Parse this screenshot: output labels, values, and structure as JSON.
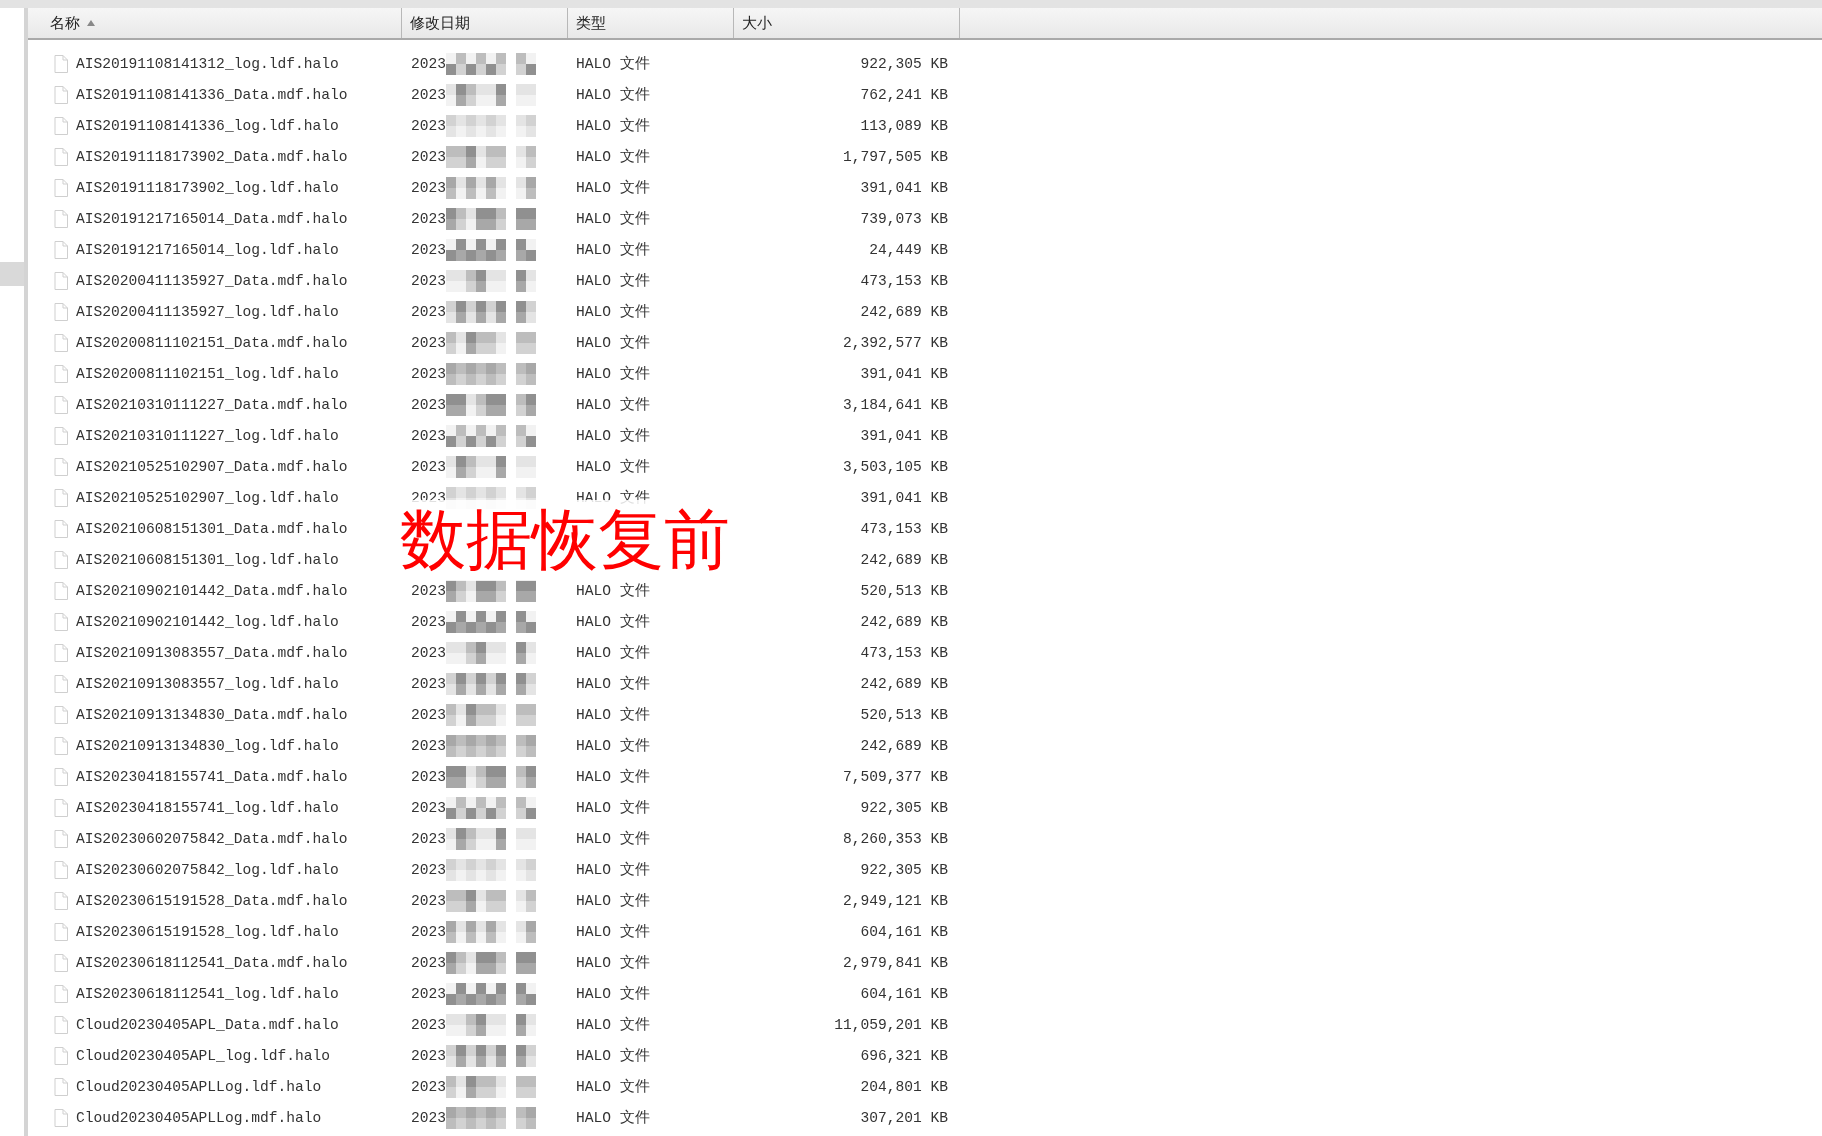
{
  "columns": [
    {
      "label": "名称",
      "sorted": true
    },
    {
      "label": "修改日期",
      "sorted": false
    },
    {
      "label": "类型",
      "sorted": false
    },
    {
      "label": "大小",
      "sorted": false
    }
  ],
  "rows": [
    {
      "name": "AIS20191108141312_log.ldf.halo",
      "date": "2023",
      "type": "HALO 文件",
      "size": "922,305 KB"
    },
    {
      "name": "AIS20191108141336_Data.mdf.halo",
      "date": "2023",
      "type": "HALO 文件",
      "size": "762,241 KB"
    },
    {
      "name": "AIS20191108141336_log.ldf.halo",
      "date": "2023",
      "type": "HALO 文件",
      "size": "113,089 KB"
    },
    {
      "name": "AIS20191118173902_Data.mdf.halo",
      "date": "2023",
      "type": "HALO 文件",
      "size": "1,797,505 KB"
    },
    {
      "name": "AIS20191118173902_log.ldf.halo",
      "date": "2023",
      "type": "HALO 文件",
      "size": "391,041 KB"
    },
    {
      "name": "AIS20191217165014_Data.mdf.halo",
      "date": "2023",
      "type": "HALO 文件",
      "size": "739,073 KB"
    },
    {
      "name": "AIS20191217165014_log.ldf.halo",
      "date": "2023",
      "type": "HALO 文件",
      "size": "24,449 KB"
    },
    {
      "name": "AIS20200411135927_Data.mdf.halo",
      "date": "2023",
      "type": "HALO 文件",
      "size": "473,153 KB"
    },
    {
      "name": "AIS20200411135927_log.ldf.halo",
      "date": "2023",
      "type": "HALO 文件",
      "size": "242,689 KB"
    },
    {
      "name": "AIS20200811102151_Data.mdf.halo",
      "date": "2023",
      "type": "HALO 文件",
      "size": "2,392,577 KB"
    },
    {
      "name": "AIS20200811102151_log.ldf.halo",
      "date": "2023",
      "type": "HALO 文件",
      "size": "391,041 KB"
    },
    {
      "name": "AIS20210310111227_Data.mdf.halo",
      "date": "2023",
      "type": "HALO 文件",
      "size": "3,184,641 KB"
    },
    {
      "name": "AIS20210310111227_log.ldf.halo",
      "date": "2023",
      "type": "HALO 文件",
      "size": "391,041 KB"
    },
    {
      "name": "AIS20210525102907_Data.mdf.halo",
      "date": "2023",
      "type": "HALO 文件",
      "size": "3,503,105 KB"
    },
    {
      "name": "AIS20210525102907_log.ldf.halo",
      "date": "2023",
      "type": "HALO 文件",
      "size": "391,041 KB"
    },
    {
      "name": "AIS20210608151301_Data.mdf.halo",
      "size": "473,153 KB"
    },
    {
      "name": "AIS20210608151301_log.ldf.halo",
      "size": "242,689 KB"
    },
    {
      "name": "AIS20210902101442_Data.mdf.halo",
      "date": "2023",
      "type": "HALO 文件",
      "size": "520,513 KB"
    },
    {
      "name": "AIS20210902101442_log.ldf.halo",
      "date": "2023",
      "type": "HALO 文件",
      "size": "242,689 KB"
    },
    {
      "name": "AIS20210913083557_Data.mdf.halo",
      "date": "2023",
      "type": "HALO 文件",
      "size": "473,153 KB"
    },
    {
      "name": "AIS20210913083557_log.ldf.halo",
      "date": "2023",
      "type": "HALO 文件",
      "size": "242,689 KB"
    },
    {
      "name": "AIS20210913134830_Data.mdf.halo",
      "date": "2023",
      "type": "HALO 文件",
      "size": "520,513 KB"
    },
    {
      "name": "AIS20210913134830_log.ldf.halo",
      "date": "2023",
      "type": "HALO 文件",
      "size": "242,689 KB"
    },
    {
      "name": "AIS20230418155741_Data.mdf.halo",
      "date": "2023",
      "type": "HALO 文件",
      "size": "7,509,377 KB"
    },
    {
      "name": "AIS20230418155741_log.ldf.halo",
      "date": "2023",
      "type": "HALO 文件",
      "size": "922,305 KB"
    },
    {
      "name": "AIS20230602075842_Data.mdf.halo",
      "date": "2023",
      "type": "HALO 文件",
      "size": "8,260,353 KB"
    },
    {
      "name": "AIS20230602075842_log.ldf.halo",
      "date": "2023",
      "type": "HALO 文件",
      "size": "922,305 KB"
    },
    {
      "name": "AIS20230615191528_Data.mdf.halo",
      "date": "2023",
      "type": "HALO 文件",
      "size": "2,949,121 KB"
    },
    {
      "name": "AIS20230615191528_log.ldf.halo",
      "date": "2023",
      "type": "HALO 文件",
      "size": "604,161 KB"
    },
    {
      "name": "AIS20230618112541_Data.mdf.halo",
      "date": "2023",
      "type": "HALO 文件",
      "size": "2,979,841 KB"
    },
    {
      "name": "AIS20230618112541_log.ldf.halo",
      "date": "2023",
      "type": "HALO 文件",
      "size": "604,161 KB"
    },
    {
      "name": "Cloud20230405APL_Data.mdf.halo",
      "date": "2023",
      "type": "HALO 文件",
      "size": "11,059,201 KB"
    },
    {
      "name": "Cloud20230405APL_log.ldf.halo",
      "date": "2023",
      "type": "HALO 文件",
      "size": "696,321 KB"
    },
    {
      "name": "Cloud20230405APLLog.ldf.halo",
      "date": "2023",
      "type": "HALO 文件",
      "size": "204,801 KB"
    },
    {
      "name": "Cloud20230405APLLog.mdf.halo",
      "date": "2023",
      "type": "HALO 文件",
      "size": "307,201 KB"
    }
  ],
  "overlay_label": "数据恢复前"
}
